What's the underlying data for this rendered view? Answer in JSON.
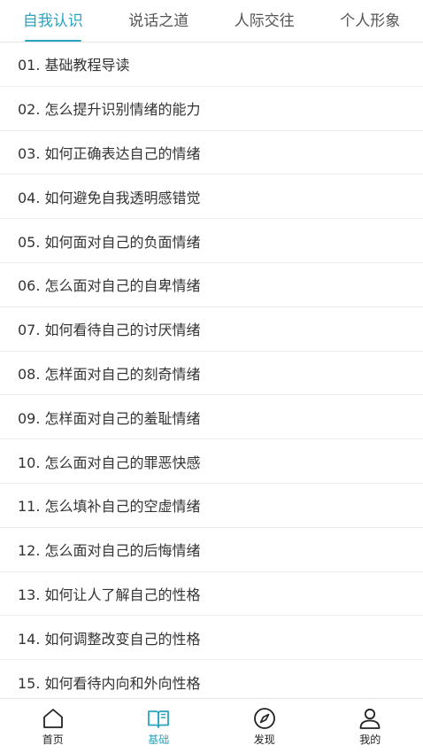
{
  "tabs": [
    {
      "label": "自我认识",
      "active": true
    },
    {
      "label": "说话之道",
      "active": false
    },
    {
      "label": "人际交往",
      "active": false
    },
    {
      "label": "个人形象",
      "active": false
    }
  ],
  "lessons": [
    "01. 基础教程导读",
    "02. 怎么提升识别情绪的能力",
    "03. 如何正确表达自己的情绪",
    "04. 如何避免自我透明感错觉",
    "05. 如何面对自己的负面情绪",
    "06. 怎么面对自己的自卑情绪",
    "07. 如何看待自己的讨厌情绪",
    "08. 怎样面对自己的刻奇情绪",
    "09. 怎样面对自己的羞耻情绪",
    "10. 怎么面对自己的罪恶快感",
    "11. 怎么填补自己的空虚情绪",
    "12. 怎么面对自己的后悔情绪",
    "13. 如何让人了解自己的性格",
    "14. 如何调整改变自己的性格",
    "15. 如何看待内向和外向性格"
  ],
  "bottom_nav": [
    {
      "label": "首页",
      "icon": "home-icon",
      "active": false
    },
    {
      "label": "基础",
      "icon": "book-icon",
      "active": true
    },
    {
      "label": "发现",
      "icon": "compass-icon",
      "active": false
    },
    {
      "label": "我的",
      "icon": "person-icon",
      "active": false
    }
  ],
  "colors": {
    "accent": "#2aa4c0",
    "text": "#333333",
    "divider": "#ececec"
  }
}
